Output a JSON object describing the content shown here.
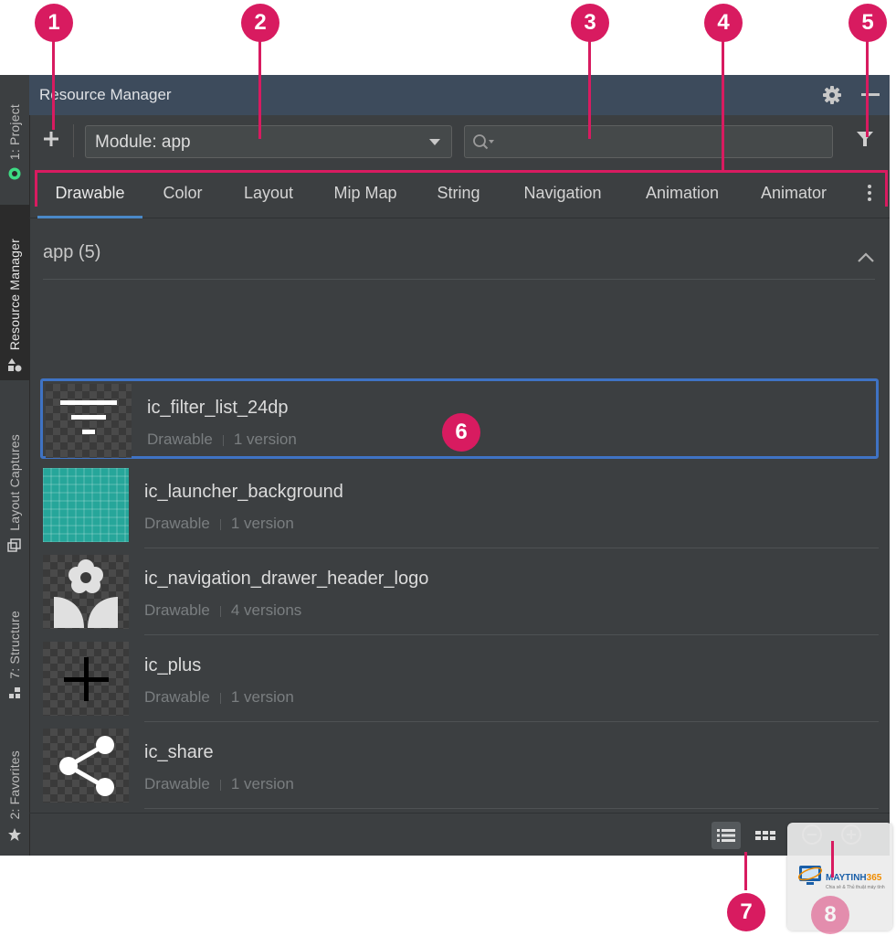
{
  "window": {
    "title": "Resource Manager"
  },
  "sidebar": {
    "tabs": [
      {
        "label": "1: Project",
        "icon": "android-icon"
      },
      {
        "label": "Resource Manager",
        "icon": "resources-icon",
        "active": true
      },
      {
        "label": "Layout Captures",
        "icon": "layout-capture-icon"
      },
      {
        "label": "7: Structure",
        "icon": "structure-icon"
      },
      {
        "label": "2: Favorites",
        "icon": "star-icon"
      }
    ]
  },
  "toolbar": {
    "add_icon": "plus-icon",
    "module_value": "Module: app",
    "search_value": "",
    "search_placeholder": "",
    "filter_icon": "filter-icon"
  },
  "tabs": [
    {
      "label": "Drawable",
      "active": true
    },
    {
      "label": "Color"
    },
    {
      "label": "Layout"
    },
    {
      "label": "Mip Map"
    },
    {
      "label": "String"
    },
    {
      "label": "Navigation"
    },
    {
      "label": "Animation"
    },
    {
      "label": "Animator"
    }
  ],
  "group": {
    "label": "app (5)"
  },
  "resources": [
    {
      "name": "ic_filter_list_24dp",
      "type": "Drawable",
      "versions": "1 version",
      "preview": "filter-list-preview",
      "selected": true
    },
    {
      "name": "ic_launcher_background",
      "type": "Drawable",
      "versions": "1 version",
      "preview": "launcher-background-preview"
    },
    {
      "name": "ic_navigation_drawer_header_logo",
      "type": "Drawable",
      "versions": "4 versions",
      "preview": "flower-logo-preview"
    },
    {
      "name": "ic_plus",
      "type": "Drawable",
      "versions": "1 version",
      "preview": "plus-preview"
    },
    {
      "name": "ic_share",
      "type": "Drawable",
      "versions": "1 version",
      "preview": "share-preview"
    }
  ],
  "bottom_bar": {
    "list_view_icon": "list-view-icon",
    "grid_view_icon": "grid-view-icon",
    "zoom_out_icon": "zoom-out-icon",
    "zoom_in_icon": "zoom-in-icon"
  },
  "callouts": [
    "1",
    "2",
    "3",
    "4",
    "5",
    "6",
    "7",
    "8"
  ],
  "watermark": {
    "brand_prefix": "MAYTINH",
    "brand_number": "365",
    "subtitle": "Chia sẻ & Thủ thuật máy tính"
  },
  "colors": {
    "panel_bg": "#3c3f41",
    "header_bg": "#3d4b5c",
    "accent_blue": "#4a88c7",
    "selection_border": "#3f73c4",
    "callout": "#d81b60",
    "launcher_teal": "#26a69a"
  }
}
